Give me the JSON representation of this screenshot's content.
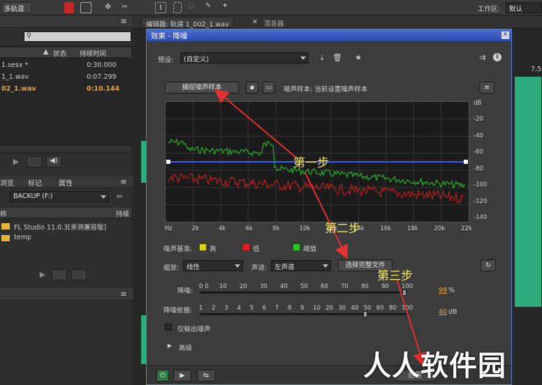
{
  "topbar": {
    "multitrack_label": "多轨混音",
    "workspace_label": "工作区:",
    "workspace_value": "默认"
  },
  "files_panel": {
    "columns": {
      "status": "状态",
      "duration": "持续时间"
    },
    "files": [
      {
        "name": "1.sesx *",
        "duration": "0:30.000"
      },
      {
        "name": "1_1.wav",
        "duration": "0:07.299"
      },
      {
        "name": "02_1.wav",
        "duration": "0:10.144"
      }
    ]
  },
  "media_panel": {
    "tabs": [
      "浏览",
      "标记",
      "属性"
    ],
    "drive_label": "BACKUP (F:)",
    "column_name": "称",
    "column_duration": "持续",
    "folders": [
      "FL Studio 11.0.3[亲测兼容版]",
      "temp"
    ]
  },
  "editor": {
    "tab_label": "编辑器: 轨道 1_002_1.wav",
    "mixer_tab": "混音器",
    "ruler_value": "7.5"
  },
  "dialog": {
    "title": "效果 - 降噪",
    "preset_label": "预设:",
    "preset_value": "(自定义)",
    "capture_button": "捕捉噪声样本",
    "noise_sample_text": "噪声样本: 当前设置噪声样本",
    "graph": {
      "db_labels": [
        "dB",
        "-20",
        "-40",
        "-60",
        "-80",
        "-100",
        "-120",
        "-140"
      ],
      "hz_labels": [
        "Hz",
        "2k",
        "4k",
        "6k",
        "8k",
        "10k",
        "12k",
        "14k",
        "16k",
        "18k",
        "20k",
        "22k"
      ]
    },
    "legend": {
      "label": "噪声基准:",
      "items": [
        {
          "name": "高",
          "color": "#e6d21a"
        },
        {
          "name": "低",
          "color": "#e02020"
        },
        {
          "name": "阈值",
          "color": "#2bc22b"
        }
      ]
    },
    "scale_label": "缩放:",
    "scale_value": "线性",
    "channel_label": "声道:",
    "channel_value": "左声道",
    "select_full_button": "选择完整文件",
    "reduction": {
      "label": "降噪:",
      "ticks": [
        "0 0",
        "10",
        "20",
        "30",
        "40",
        "50",
        "60",
        "70",
        "80",
        "90",
        "100"
      ],
      "value": "99",
      "unit": "%"
    },
    "reduce_by": {
      "label": "降噪依据:",
      "ticks": [
        "1",
        "2",
        "3",
        "4",
        "5",
        "6",
        "7",
        "8",
        "9",
        "10",
        "20",
        "30",
        "40",
        "50",
        "60",
        "80",
        "100"
      ],
      "value": "40",
      "unit": "dB"
    },
    "output_noise_only": "仅输出噪声",
    "advanced": "高级",
    "apply_button": "应用"
  },
  "annotations": {
    "step1": "第一步",
    "step2": "第二步",
    "step3": "第三步"
  },
  "watermark": "人人软件园"
}
